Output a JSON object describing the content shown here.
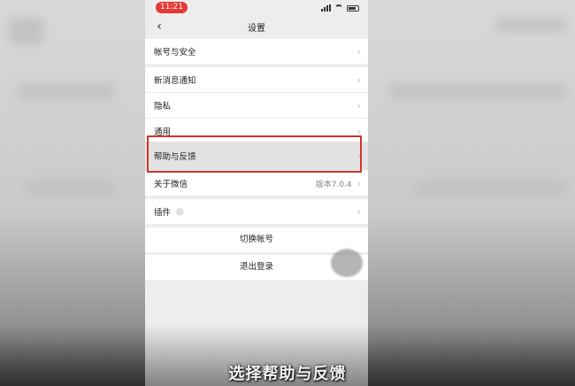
{
  "status_bar": {
    "time": "11:21"
  },
  "nav": {
    "title": "设置",
    "back": "‹"
  },
  "rows": {
    "account_security": {
      "label": "帐号与安全"
    },
    "notifications": {
      "label": "新消息通知"
    },
    "privacy": {
      "label": "隐私"
    },
    "general": {
      "label": "通用"
    },
    "help_feedback": {
      "label": "帮助与反馈"
    },
    "about": {
      "label": "关于微信",
      "value": "版本7.0.4"
    },
    "plugins": {
      "label": "插件"
    }
  },
  "chevron": "›",
  "actions": {
    "switch_account": "切换帐号",
    "logout": "退出登录"
  },
  "subtitle": "选择帮助与反馈",
  "colors": {
    "time_pill": "#e53935",
    "highlight_border": "#d0342c"
  }
}
